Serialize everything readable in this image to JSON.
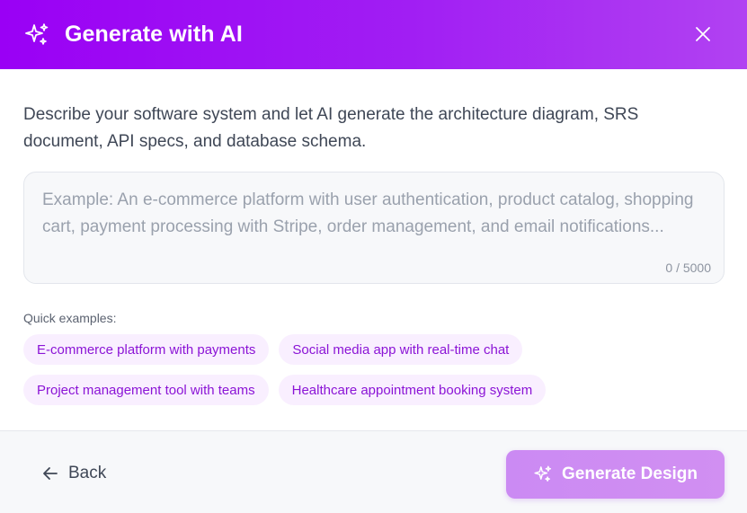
{
  "header": {
    "title": "Generate with AI",
    "icon": "sparkles-icon",
    "close_icon": "close-icon",
    "gradient_start": "#9a00f5",
    "gradient_end": "#b142f2"
  },
  "body": {
    "description": "Describe your software system and let AI generate the architecture diagram, SRS document, API specs, and database schema.",
    "textarea": {
      "value": "",
      "placeholder": "Example: An e-commerce platform with user authentication, product catalog, shopping cart, payment processing with Stripe, order management, and email notifications...",
      "counter": "0 / 5000"
    },
    "quick_examples_label": "Quick examples:",
    "quick_examples": [
      "E-commerce platform with payments",
      "Social media app with real-time chat",
      "Project management tool with teams",
      "Healthcare appointment booking system"
    ]
  },
  "footer": {
    "back_label": "Back",
    "back_icon": "arrow-left-icon",
    "generate_label": "Generate Design",
    "generate_icon": "sparkles-icon",
    "accent": "#cb8af3"
  }
}
